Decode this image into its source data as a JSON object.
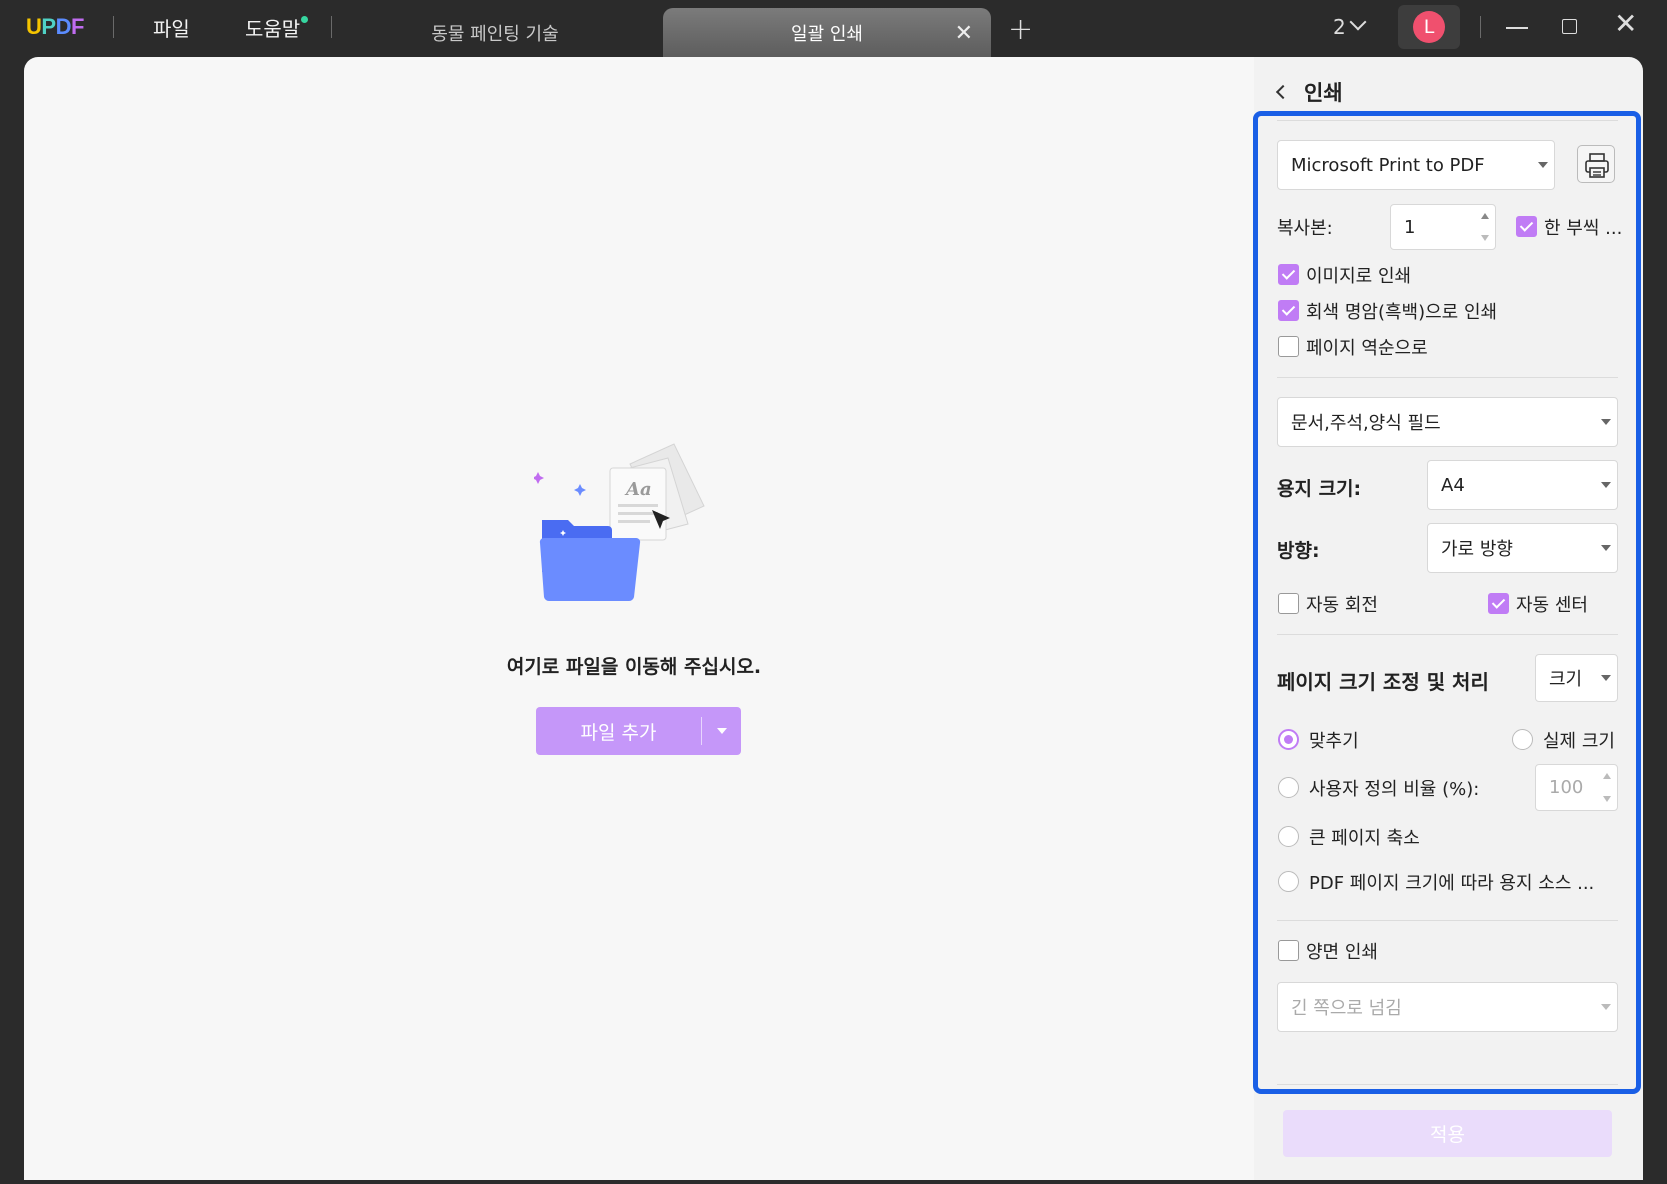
{
  "titlebar": {
    "app_menu": [
      "파일",
      "도움말"
    ],
    "tabs": [
      {
        "label": "동물 페인팅 기술",
        "active": false
      },
      {
        "label": "일괄 인쇄",
        "active": true
      }
    ],
    "page_count": "2",
    "avatar_initial": "L"
  },
  "logo": {
    "u": "U",
    "p": "P",
    "d": "D",
    "f": "F"
  },
  "main": {
    "drop_text": "여기로 파일을 이동해 주십시오.",
    "add_file_label": "파일 추가"
  },
  "panel": {
    "title": "인쇄",
    "printer": "Microsoft Print to PDF",
    "copies_label": "복사본:",
    "copies_value": "1",
    "collate_label": "한 부씩 ...",
    "collate_checked": true,
    "print_as_image_label": "이미지로 인쇄",
    "print_as_image_checked": true,
    "grayscale_label": "회색 명암(흑백)으로 인쇄",
    "grayscale_checked": true,
    "reverse_label": "페이지 역순으로",
    "reverse_checked": false,
    "content_select": "문서,주석,양식 필드",
    "paper_size_label": "용지 크기:",
    "paper_size_value": "A4",
    "orientation_label": "방향:",
    "orientation_value": "가로 방향",
    "auto_rotate_label": "자동 회전",
    "auto_rotate_checked": false,
    "auto_center_label": "자동 센터",
    "auto_center_checked": true,
    "scaling_title": "페이지 크기 조정 및 처리",
    "scaling_mode": "크기",
    "fit_label": "맞추기",
    "actual_size_label": "실제 크기",
    "custom_scale_label": "사용자 정의 비율 (%):",
    "custom_scale_value": "100",
    "shrink_label": "큰 페이지 축소",
    "pdf_paper_source_label": "PDF 페이지 크기에 따라 용지 소스 ...",
    "duplex_label": "양면 인쇄",
    "duplex_checked": false,
    "flip_select": "긴 쪽으로 넘김",
    "apply_label": "적용"
  },
  "colors": {
    "accent": "#c07cf5",
    "highlight": "#1a5fe6",
    "titlebar_bg": "#2b2b2b"
  }
}
